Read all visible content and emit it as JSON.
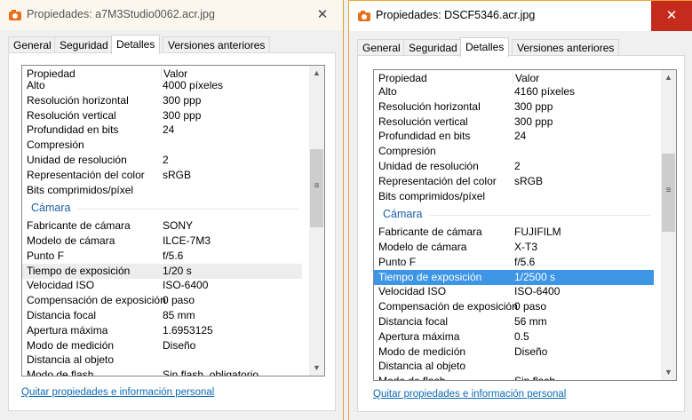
{
  "left": {
    "title": "Propiedades: a7M3Studio0062.acr.jpg",
    "close": "✕",
    "tabs": [
      "General",
      "Seguridad",
      "Detalles",
      "Versiones anteriores"
    ],
    "header": {
      "prop": "Propiedad",
      "val": "Valor"
    },
    "rows": [
      {
        "k": "Alto",
        "v": "4000 píxeles"
      },
      {
        "k": "Resolución horizontal",
        "v": "300 ppp"
      },
      {
        "k": "Resolución vertical",
        "v": "300 ppp"
      },
      {
        "k": "Profundidad en bits",
        "v": "24"
      },
      {
        "k": "Compresión",
        "v": ""
      },
      {
        "k": "Unidad de resolución",
        "v": "2"
      },
      {
        "k": "Representación del color",
        "v": "sRGB"
      },
      {
        "k": "Bits comprimidos/píxel",
        "v": ""
      },
      {
        "k": "Cámara",
        "v": "",
        "type": "section"
      },
      {
        "k": "Fabricante de cámara",
        "v": "SONY"
      },
      {
        "k": "Modelo de cámara",
        "v": "ILCE-7M3"
      },
      {
        "k": "Punto F",
        "v": "f/5.6"
      },
      {
        "k": "Tiempo de exposición",
        "v": "1/20 s",
        "type": "hover"
      },
      {
        "k": "Velocidad ISO",
        "v": "ISO-6400"
      },
      {
        "k": "Compensación de exposición",
        "v": "0 paso"
      },
      {
        "k": "Distancia focal",
        "v": "85 mm"
      },
      {
        "k": "Apertura máxima",
        "v": "1.6953125"
      },
      {
        "k": "Modo de medición",
        "v": "Diseño"
      },
      {
        "k": "Distancia al objeto",
        "v": ""
      },
      {
        "k": "Modo de flash",
        "v": "Sin flash, obligatorio"
      }
    ],
    "link": "Quitar propiedades e información personal"
  },
  "right": {
    "title": "Propiedades: DSCF5346.acr.jpg",
    "close": "✕",
    "tabs": [
      "General",
      "Seguridad",
      "Detalles",
      "Versiones anteriores"
    ],
    "header": {
      "prop": "Propiedad",
      "val": "Valor"
    },
    "rows": [
      {
        "k": "Alto",
        "v": "4160 píxeles"
      },
      {
        "k": "Resolución horizontal",
        "v": "300 ppp"
      },
      {
        "k": "Resolución vertical",
        "v": "300 ppp"
      },
      {
        "k": "Profundidad en bits",
        "v": "24"
      },
      {
        "k": "Compresión",
        "v": ""
      },
      {
        "k": "Unidad de resolución",
        "v": "2"
      },
      {
        "k": "Representación del color",
        "v": "sRGB"
      },
      {
        "k": "Bits comprimidos/píxel",
        "v": ""
      },
      {
        "k": "Cámara",
        "v": "",
        "type": "section"
      },
      {
        "k": "Fabricante de cámara",
        "v": "FUJIFILM"
      },
      {
        "k": "Modelo de cámara",
        "v": "X-T3"
      },
      {
        "k": "Punto F",
        "v": "f/5.6"
      },
      {
        "k": "Tiempo de exposición",
        "v": "1/2500 s",
        "type": "selected"
      },
      {
        "k": "Velocidad ISO",
        "v": "ISO-6400"
      },
      {
        "k": "Compensación de exposición",
        "v": "0 paso"
      },
      {
        "k": "Distancia focal",
        "v": "56 mm"
      },
      {
        "k": "Apertura máxima",
        "v": "0.5"
      },
      {
        "k": "Modo de medición",
        "v": "Diseño"
      },
      {
        "k": "Distancia al objeto",
        "v": ""
      },
      {
        "k": "Modo de flash",
        "v": "Sin flash"
      }
    ],
    "link": "Quitar propiedades e información personal"
  },
  "scrollbar": {
    "up": "▲",
    "down": "▼",
    "grip": "≡"
  }
}
